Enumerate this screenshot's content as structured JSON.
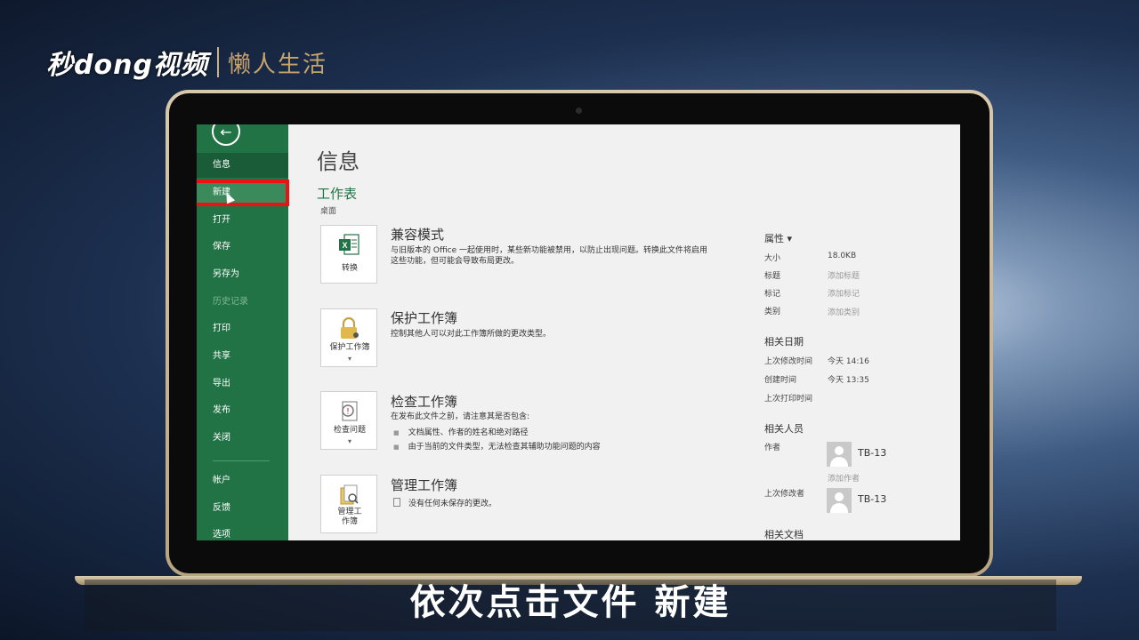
{
  "brand": {
    "logo_main": "秒dong视频",
    "logo_sub": "懒人生活"
  },
  "sidebar": {
    "items": [
      {
        "label": "信息",
        "state": "active"
      },
      {
        "label": "新建",
        "state": "hover"
      },
      {
        "label": "打开",
        "state": "normal"
      },
      {
        "label": "保存",
        "state": "normal"
      },
      {
        "label": "另存为",
        "state": "normal"
      },
      {
        "label": "历史记录",
        "state": "disabled"
      },
      {
        "label": "打印",
        "state": "normal"
      },
      {
        "label": "共享",
        "state": "normal"
      },
      {
        "label": "导出",
        "state": "normal"
      },
      {
        "label": "发布",
        "state": "normal"
      },
      {
        "label": "关闭",
        "state": "normal"
      },
      {
        "label": "帐户",
        "state": "normal"
      },
      {
        "label": "反馈",
        "state": "normal"
      },
      {
        "label": "选项",
        "state": "normal"
      }
    ]
  },
  "main": {
    "title": "信息",
    "doc_name": "工作表",
    "doc_location": "桌面",
    "cards": [
      {
        "button_label": "转换",
        "title": "兼容模式",
        "desc": "与旧版本的 Office 一起使用时，某些新功能被禁用，以防止出现问题。转换此文件将启用这些功能，但可能会导致布局更改。",
        "icon": "excel-convert-icon"
      },
      {
        "button_label": "保护工作簿",
        "title": "保护工作簿",
        "desc": "控制其他人可以对此工作簿所做的更改类型。",
        "icon": "lock-icon"
      },
      {
        "button_label": "检查问题",
        "title": "检查工作簿",
        "desc": "在发布此文件之前，请注意其是否包含:",
        "bullets": [
          "文档属性、作者的姓名和绝对路径",
          "由于当前的文件类型，无法检查其辅助功能问题的内容"
        ],
        "icon": "inspect-icon"
      },
      {
        "button_label_1": "管理工",
        "button_label_2": "作簿",
        "title": "管理工作簿",
        "desc": "没有任何未保存的更改。",
        "icon": "manage-workbook-icon"
      }
    ]
  },
  "properties": {
    "header": "属性",
    "size_key": "大小",
    "size_val": "18.0KB",
    "title_key": "标题",
    "title_val": "添加标题",
    "tags_key": "标记",
    "tags_val": "添加标记",
    "category_key": "类别",
    "category_val": "添加类别",
    "dates_header": "相关日期",
    "modified_key": "上次修改时间",
    "modified_val": "今天 14:16",
    "created_key": "创建时间",
    "created_val": "今天 13:35",
    "printed_key": "上次打印时间",
    "people_header": "相关人员",
    "author_key": "作者",
    "author_name": "TB-13",
    "add_author": "添加作者",
    "last_modified_by_key": "上次修改者",
    "last_modified_by_name": "TB-13",
    "related_docs_header": "相关文档"
  },
  "subtitle": "依次点击文件 新建",
  "colors": {
    "excel_green": "#217346",
    "highlight_red": "#e11111"
  }
}
